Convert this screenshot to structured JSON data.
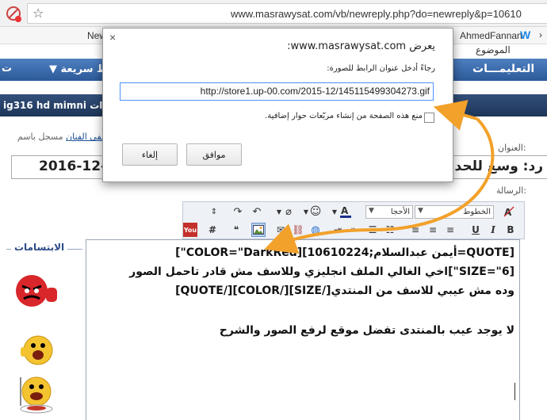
{
  "browser": {
    "url": "www.masrawysat.com/vb/newreply.php?do=newreply&p=10610",
    "bookmarks": {
      "item_new": "New",
      "item_user": "AhmedFannan",
      "item_w": "W"
    }
  },
  "nav": {
    "instructions": "التعليمـــات",
    "quick_links": "▼ روابط سريعة",
    "left_fragment": "ت",
    "top_title_fragment": "الموضوع"
  },
  "thread": {
    "title": "ig316 hd mimni قاقرات"
  },
  "form": {
    "posted_by_label": "مسجل باسم :",
    "posted_by_user": "مصطفى الفنان",
    "title_label": "العنوان:",
    "title_value_re": "رد: وسع للحد",
    "title_value_date": "2016-12-",
    "message_label": "الرسالة:"
  },
  "toolbar": {
    "font_select": "الخطوط",
    "size_select": "الأحجا",
    "color_icon": "font-color-icon"
  },
  "message": {
    "line1": "[QUOTE=أيمن عبدالسلام;10610224][COLOR=\"DarkRed\"]",
    "line2": "[SIZE=\"6\"]اخي الغالي الملف انجليزي وللاسف  مش قادر تاحمل الصور",
    "line3": "وده مش عيبي للاسف من المنتدي[/SIZE][/COLOR][/QUOTE]",
    "line4": "لا يوجد عيب بالمنتدى تفضل موقع لرفع الصور والشرح"
  },
  "smilies": {
    "title": "الابتسامات"
  },
  "dialog": {
    "close": "×",
    "heading": "يعرض www.masrawysat.com:",
    "prompt": "رجاءً أدخل عنوان الرابط للصورة:",
    "input_value": "http://store1.up-00.com/2015-12/145115499304273.gif",
    "checkbox_label": "منع هذه الصفحة من إنشاء مربّعات حوار إضافية.",
    "ok": "موافق",
    "cancel": "إلغاء"
  },
  "colors": {
    "nav_blue": "#3a6aab",
    "thread_bar": "#283f68",
    "arrow_orange": "#f2a12a",
    "dialog_input_border": "#4d90fe"
  }
}
